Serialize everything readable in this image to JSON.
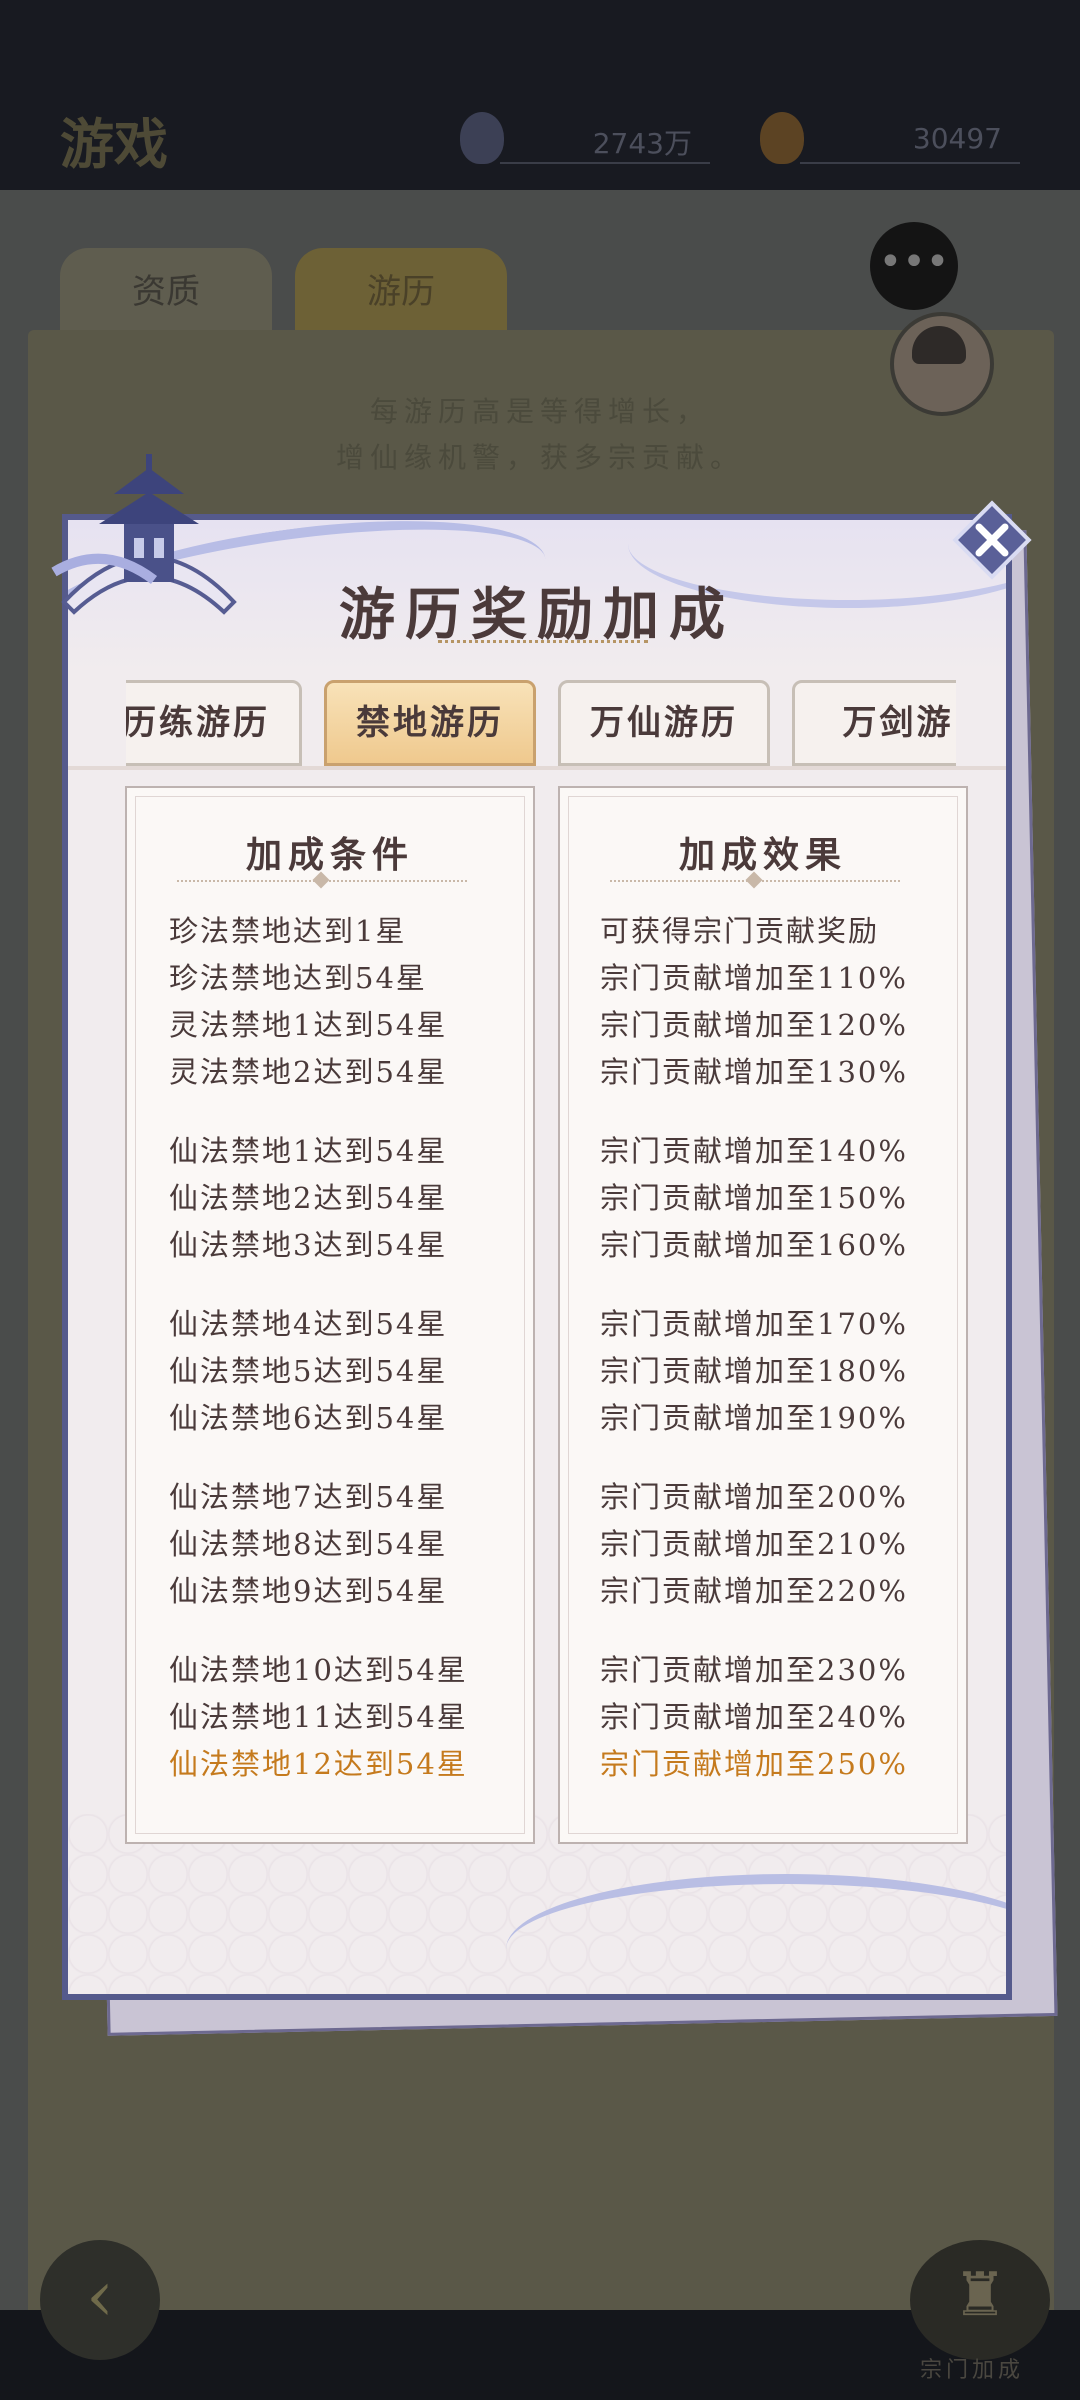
{
  "background": {
    "title": "游戏",
    "resource_1": "2743万",
    "resource_2": "30497",
    "tabs": [
      "资质",
      "游历"
    ],
    "lines": [
      "每游历高是等得增长，",
      "增仙缘机警，获多宗贡献。"
    ],
    "bottom_right_label": "宗门加成"
  },
  "dialog": {
    "title": "游历奖励加成",
    "tabs": [
      {
        "label": "历练游历",
        "active": false
      },
      {
        "label": "禁地游历",
        "active": true
      },
      {
        "label": "万仙游历",
        "active": false
      },
      {
        "label": "万剑游",
        "active": false
      }
    ],
    "conditions_header": "加成条件",
    "effects_header": "加成效果",
    "groups": [
      [
        {
          "condition": "珍法禁地达到1星",
          "effect": "可获得宗门贡献奖励"
        },
        {
          "condition": "珍法禁地达到54星",
          "effect": "宗门贡献增加至110%"
        },
        {
          "condition": "灵法禁地1达到54星",
          "effect": "宗门贡献增加至120%"
        },
        {
          "condition": "灵法禁地2达到54星",
          "effect": "宗门贡献增加至130%"
        }
      ],
      [
        {
          "condition": "仙法禁地1达到54星",
          "effect": "宗门贡献增加至140%"
        },
        {
          "condition": "仙法禁地2达到54星",
          "effect": "宗门贡献增加至150%"
        },
        {
          "condition": "仙法禁地3达到54星",
          "effect": "宗门贡献增加至160%"
        }
      ],
      [
        {
          "condition": "仙法禁地4达到54星",
          "effect": "宗门贡献增加至170%"
        },
        {
          "condition": "仙法禁地5达到54星",
          "effect": "宗门贡献增加至180%"
        },
        {
          "condition": "仙法禁地6达到54星",
          "effect": "宗门贡献增加至190%"
        }
      ],
      [
        {
          "condition": "仙法禁地7达到54星",
          "effect": "宗门贡献增加至200%"
        },
        {
          "condition": "仙法禁地8达到54星",
          "effect": "宗门贡献增加至210%"
        },
        {
          "condition": "仙法禁地9达到54星",
          "effect": "宗门贡献增加至220%"
        }
      ],
      [
        {
          "condition": "仙法禁地10达到54星",
          "effect": "宗门贡献增加至230%"
        },
        {
          "condition": "仙法禁地11达到54星",
          "effect": "宗门贡献增加至240%"
        },
        {
          "condition": "仙法禁地12达到54星",
          "effect": "宗门贡献增加至250%",
          "current": true
        }
      ]
    ]
  },
  "colors": {
    "dialog_border": "#555a8c",
    "active_tab": "#efc98e",
    "highlight_text": "#c57a1d",
    "body_text": "#4a3a3a"
  },
  "icons": {
    "close": "close-icon",
    "chat": "chat-bubble-icon",
    "back": "back-arrow-icon"
  }
}
